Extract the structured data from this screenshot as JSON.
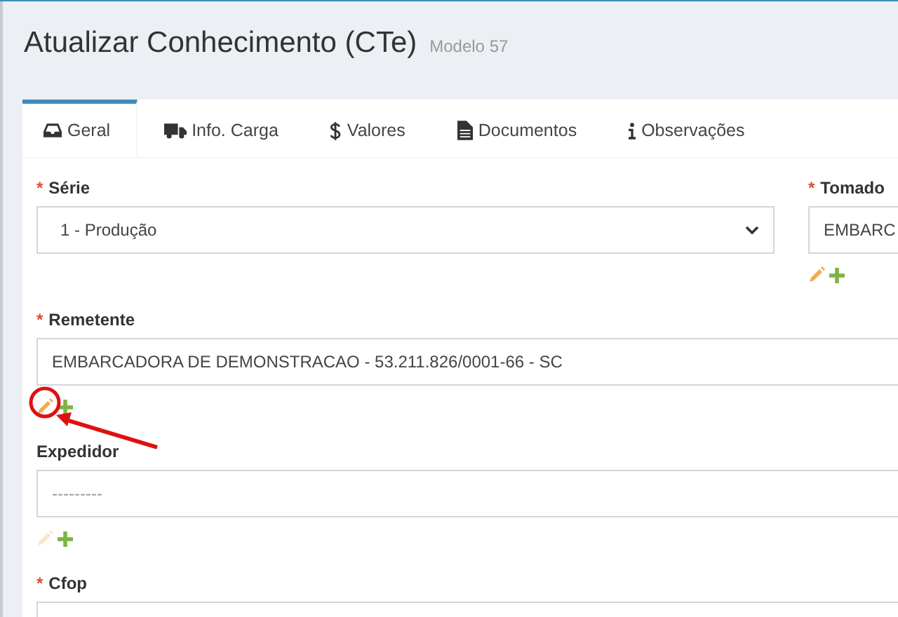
{
  "header": {
    "title": "Atualizar Conhecimento (CTe)",
    "subtitle": "Modelo 57"
  },
  "tabs": [
    {
      "label": "Geral",
      "selected": true
    },
    {
      "label": "Info. Carga",
      "selected": false
    },
    {
      "label": "Valores",
      "selected": false
    },
    {
      "label": "Documentos",
      "selected": false
    },
    {
      "label": "Observações",
      "selected": false
    }
  ],
  "form_rows": [
    [
      {
        "required_mark": "*",
        "label": "Série",
        "kind": "select",
        "value": "1 - Produção"
      },
      {
        "required_mark": "*",
        "label": "Tomado",
        "kind": "text",
        "value": "EMBARC",
        "actions": {
          "edit_enabled": true
        }
      }
    ],
    [
      {
        "required_mark": "*",
        "label": "Remetente",
        "kind": "text",
        "value": "EMBARCADORA DE DEMONSTRACAO - 53.211.826/0001-66 - SC",
        "actions": {
          "edit_enabled": true
        },
        "highlighted": true
      }
    ],
    [
      {
        "label": "Expedidor",
        "kind": "text",
        "placeholder": "---------",
        "actions": {
          "edit_enabled": false
        }
      }
    ],
    [
      {
        "required_mark": "*",
        "label": "Cfop",
        "kind": "text"
      }
    ]
  ]
}
